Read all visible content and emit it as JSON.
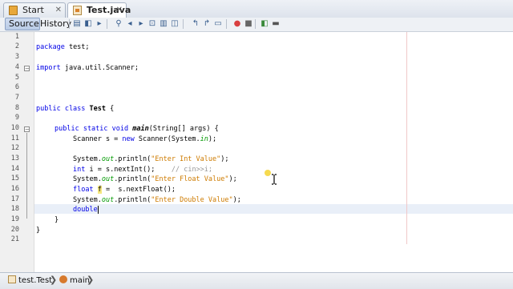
{
  "tabs": [
    {
      "label": "Start Page",
      "close": "✕"
    },
    {
      "label": "Test.java",
      "close": "✕"
    }
  ],
  "editor_toolbar": {
    "source_label": "Source",
    "history_label": "History"
  },
  "line_numbers": [
    "1",
    "2",
    "3",
    "4",
    "5",
    "6",
    "7",
    "8",
    "9",
    "10",
    "11",
    "12",
    "13",
    "14",
    "15",
    "16",
    "17",
    "18",
    "19",
    "20",
    "21"
  ],
  "code": {
    "l2": {
      "kw": "package",
      "rest": " test;"
    },
    "l4": {
      "kw": "import",
      "rest": " java.util.Scanner;"
    },
    "l8": {
      "kw": "public class",
      "name": " Test",
      "rest": " {"
    },
    "l10": {
      "kw": "public static void",
      "method": "main",
      "rest": "(String[] args) {"
    },
    "l11": {
      "a": "Scanner s = ",
      "kw": "new",
      "b": " Scanner(System.",
      "field": "in",
      "c": ");"
    },
    "l13": {
      "a": "System.",
      "field": "out",
      "b": ".println(",
      "str": "\"Enter Int Value\"",
      "c": ");"
    },
    "l14": {
      "kw": "int",
      "var": "i",
      "a": " = s.nextInt();",
      "comment": "// cin>>i;"
    },
    "l15": {
      "a": "System.",
      "field": "out",
      "b": ".println(",
      "str": "\"Enter Float Value\"",
      "c": ");"
    },
    "l16": {
      "kw": "float",
      "var": "f",
      "a": " =  s.nextFloat();"
    },
    "l17": {
      "a": "System.",
      "field": "out",
      "b": ".println(",
      "str": "\"Enter Double Value\"",
      "c": ");"
    },
    "l18": {
      "kw": "double"
    },
    "l20": {
      "a": "}"
    },
    "l21": {
      "a": "}"
    }
  },
  "breadcrumb": [
    {
      "label": "test.Test"
    },
    {
      "label": "main"
    }
  ],
  "colors": {
    "keyword": "#0000e6",
    "string": "#ce7b00",
    "field": "#009900",
    "comment": "#969696",
    "current_line": "#e9eff8"
  }
}
